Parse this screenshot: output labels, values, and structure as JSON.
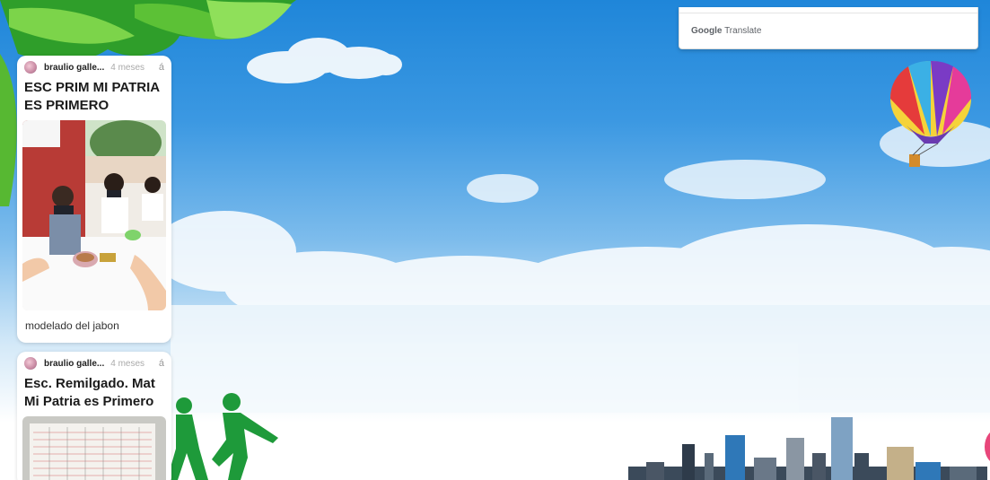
{
  "posts": [
    {
      "author": "braulio galle...",
      "time": "4 meses",
      "more": "á",
      "title": "ESC PRIM MI PATRIA ES PRIMERO",
      "caption": "modelado del jabon"
    },
    {
      "author": "braulio galle...",
      "time": "4 meses",
      "more": "á",
      "title": "Esc. Remilgado. Mat Mi Patria es Primero"
    }
  ],
  "translate": {
    "brand_google": "Google",
    "brand_translate": "Translate"
  },
  "colors": {
    "sky_top": "#1f86d9",
    "leaf_green": "#5cc136",
    "runner_green": "#1e9a3a",
    "accent_pink": "#e8467a"
  }
}
